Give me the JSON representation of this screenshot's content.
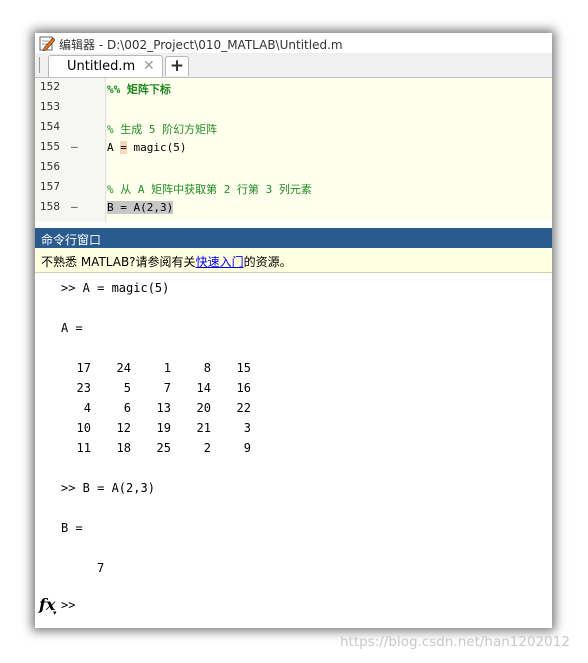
{
  "window": {
    "title": "编辑器 - D:\\002_Project\\010_MATLAB\\Untitled.m"
  },
  "tabs": {
    "active": "Untitled.m",
    "close_glyph": "✕",
    "add_glyph": "+"
  },
  "editor": {
    "lines": [
      {
        "num": "152",
        "dash": "",
        "text": "%% 矩阵下标"
      },
      {
        "num": "153",
        "dash": "",
        "text": ""
      },
      {
        "num": "154",
        "dash": "",
        "text": "% 生成 5 阶幻方矩阵"
      },
      {
        "num": "155",
        "dash": "–",
        "pre": "A ",
        "cursor_char": "=",
        "post": " magic(5)"
      },
      {
        "num": "156",
        "dash": "",
        "text": ""
      },
      {
        "num": "157",
        "dash": "",
        "text": "% 从 A 矩阵中获取第 2 行第 3 列元素"
      },
      {
        "num": "158",
        "dash": "–",
        "text": "B = A(2,3)"
      }
    ]
  },
  "command_window": {
    "header": "命令行窗口",
    "notice_prefix": "不熟悉 MATLAB?请参阅有关",
    "notice_link": "快速入门",
    "notice_suffix": "的资源。",
    "cmd1": ">> A = magic(5)",
    "var_a": "A =",
    "matrix": [
      [
        "17",
        "24",
        "1",
        "8",
        "15"
      ],
      [
        "23",
        "5",
        "7",
        "14",
        "16"
      ],
      [
        "4",
        "6",
        "13",
        "20",
        "22"
      ],
      [
        "10",
        "12",
        "19",
        "21",
        "3"
      ],
      [
        "11",
        "18",
        "25",
        "2",
        "9"
      ]
    ],
    "cmd2": ">> B = A(2,3)",
    "var_b": "B =",
    "result_b": "7",
    "fx_label": "fx",
    "fx_arrow": "▾",
    "prompt": ">>"
  },
  "watermark": "https://blog.csdn.net/han1202012",
  "colors": {
    "editor_bg": "#ffffee",
    "comment": "#228b22",
    "cmd_header": "#2a5b8f",
    "notice_bg": "#ffffe1",
    "link": "#0000ee"
  },
  "icons": {
    "title_icon": "pencil-edit-icon",
    "fx_icon": "function-fx-icon"
  }
}
